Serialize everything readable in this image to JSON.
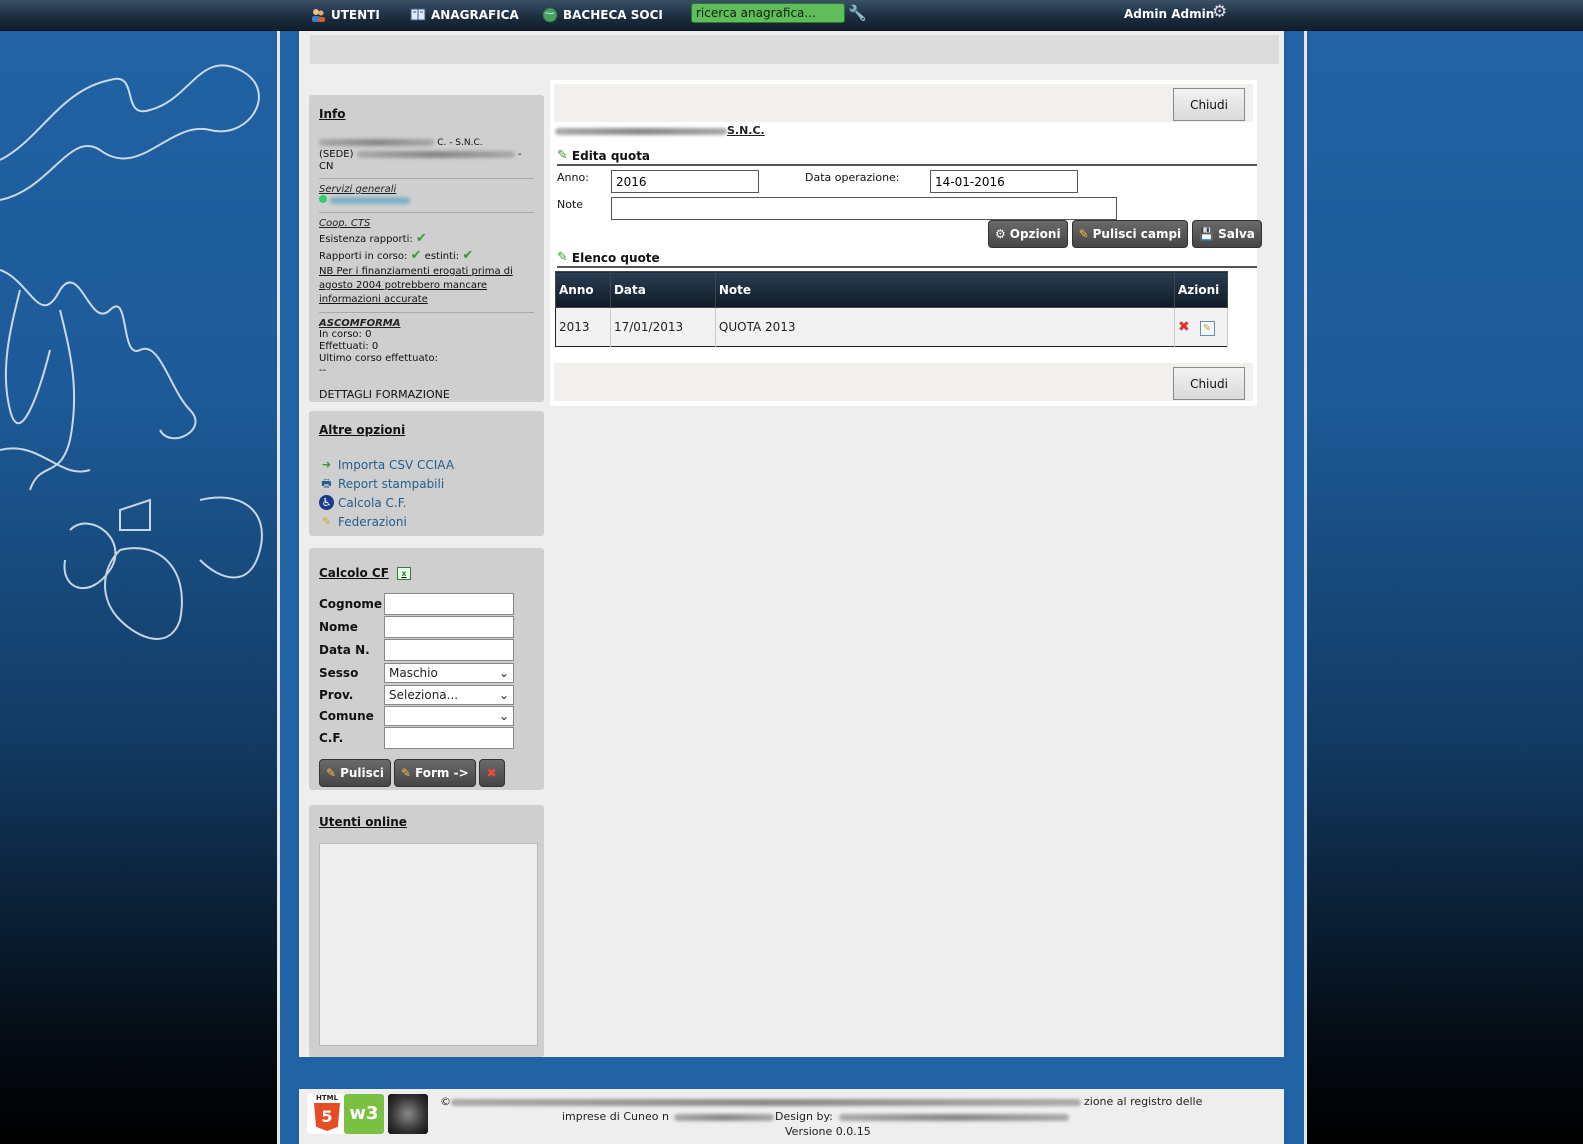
{
  "nav": {
    "utenti": "UTENTI",
    "anagrafica": "ANAGRAFICA",
    "bacheca": "BACHECA SOCI",
    "search_value": "ricerca anagrafica...",
    "user": "Admin Admin"
  },
  "info": {
    "title": "Info",
    "company_suffix": "C. - S.N.C.",
    "sede_label": "(SEDE)",
    "sede_suffix": "-",
    "province": "CN",
    "servizi": "Servizi generali",
    "coop": "Coop. CTS",
    "esistenza": "Esistenza rapporti:",
    "rapporti_corso": "Rapporti in corso:",
    "estinti": "estinti:",
    "nb": "NB Per i finanziamenti erogati prima di agosto 2004 potrebbero mancare informazioni accurate",
    "ascomforma": "ASCOMFORMA",
    "in_corso": "In corso: 0",
    "effettuati": "Effettuati: 0",
    "ultimo": "Ultimo corso effettuato:",
    "ultimo_val": "--",
    "dettagli": "DETTAGLI FORMAZIONE"
  },
  "altre": {
    "title": "Altre opzioni",
    "items": [
      "Importa CSV CCIAA",
      "Report stampabili",
      "Calcola C.F.",
      "Federazioni"
    ]
  },
  "calcolo": {
    "title": "Calcolo CF",
    "cognome": "Cognome",
    "nome": "Nome",
    "data": "Data N.",
    "sesso": "Sesso",
    "sesso_val": "Maschio",
    "prov": "Prov.",
    "prov_val": "Seleziona...",
    "comune": "Comune",
    "cf": "C.F.",
    "pulisci": "Pulisci",
    "form": "Form ->"
  },
  "online": {
    "title": "Utenti online"
  },
  "panel": {
    "chiudi": "Chiudi",
    "company": "S.N.C.",
    "edita": "Edita quota",
    "anno_label": "Anno:",
    "anno_val": "2016",
    "data_op_label": "Data operazione:",
    "data_op_val": "14-01-2016",
    "note_label": "Note",
    "opzioni": "Opzioni",
    "pulisci_campi": "Pulisci campi",
    "salva": "Salva",
    "elenco": "Elenco quote",
    "headers": [
      "Anno",
      "Data",
      "Note",
      "Azioni"
    ],
    "row": [
      "2013",
      "17/01/2013",
      "QUOTA 2013"
    ]
  },
  "footer": {
    "line1_end": "zione al registro delle",
    "line2_start": "imprese di Cuneo n",
    "line2_design": "Design by:",
    "version": "Versione 0.0.15"
  },
  "colors": {
    "nav": "#1d2e40",
    "frame": "#2062a4",
    "accent_green": "#5fbe5a"
  }
}
